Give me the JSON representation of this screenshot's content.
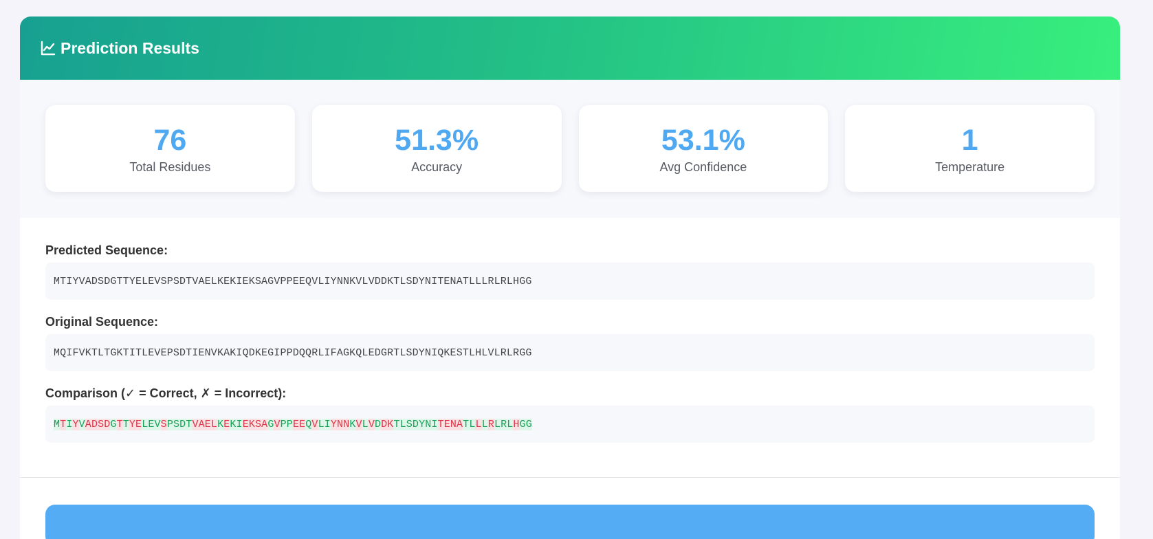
{
  "header": {
    "title": "Prediction Results",
    "icon": "chart-line-icon"
  },
  "stats": [
    {
      "value": "76",
      "label": "Total Residues"
    },
    {
      "value": "51.3%",
      "label": "Accuracy"
    },
    {
      "value": "53.1%",
      "label": "Avg Confidence"
    },
    {
      "value": "1",
      "label": "Temperature"
    }
  ],
  "predicted": {
    "label": "Predicted Sequence:",
    "sequence": "MTIYVADSDGTTYELEVSPSDTVAELKEKIEKSAGVPPEEQVLIYNNKVLVDDKTLSDYNITENATLLLRLRLHGG"
  },
  "original": {
    "label": "Original Sequence:",
    "sequence": "MQIFVKTLTGKTITLEVEPSDTIENVKAKIQDKEGIPPDQQRLIFAGKQLEDGRTLSDYNIQKESTLHLVLRLRGG"
  },
  "comparison": {
    "label": "Comparison (✓ = Correct, ✗ = Incorrect):",
    "colors": {
      "correct": "#18a055",
      "correct_bg": "#dff6ea",
      "incorrect": "#dc3545",
      "incorrect_bg": "#fbe1e3"
    }
  },
  "colors": {
    "accent": "#4fa8f2",
    "header_start": "#17a091",
    "header_end": "#38ef7d"
  }
}
